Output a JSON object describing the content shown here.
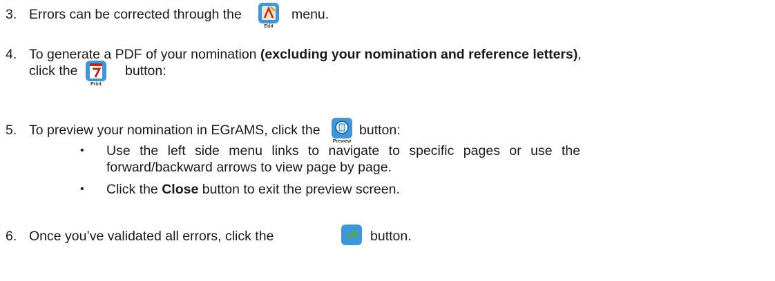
{
  "items": [
    {
      "number": "3.",
      "before": "Errors can be corrected through the",
      "after": "menu.",
      "icon": "edit-icon",
      "icon_caption": "Edit"
    },
    {
      "number": "4.",
      "line1_before": "To generate a PDF of your nomination ",
      "line1_bold": "(excluding your nomination and reference letters)",
      "line1_after": ",",
      "line2_before": "click the",
      "line2_after": "button:",
      "icon": "print-icon",
      "icon_caption": "Print"
    },
    {
      "number": "5.",
      "before": "To preview your nomination in EGrAMS, click the",
      "after": "button:",
      "icon": "preview-icon",
      "icon_caption": "Preview",
      "bullets": [
        {
          "line1": "Use the left side menu links to navigate to specific pages or use the",
          "line2": "forward/backward arrows to view page by page."
        },
        {
          "before": "Click the ",
          "bold": "Close",
          "after": " button to exit the preview screen."
        }
      ]
    },
    {
      "number": "6.",
      "before": "Once you’ve validated all errors, click the",
      "after": "button.",
      "icon": "forward-arrow-icon"
    }
  ],
  "colors": {
    "icon_blue": "#2f8fd6",
    "print_red": "#c8201e",
    "arrow_green": "#4cae3c"
  }
}
